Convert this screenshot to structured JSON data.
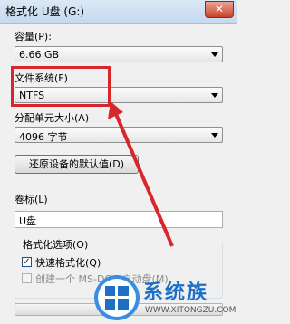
{
  "window": {
    "title": "格式化 U盘 (G:)",
    "close_glyph": "✕"
  },
  "capacity": {
    "label": "容量(P):",
    "value": "6.66 GB"
  },
  "file_system": {
    "label": "文件系统(F)",
    "value": "NTFS"
  },
  "allocation": {
    "label": "分配单元大小(A)",
    "value": "4096 字节"
  },
  "restore_button": "还原设备的默认值(D)",
  "volume_label": {
    "label": "卷标(L)",
    "value": "U盘"
  },
  "format_options": {
    "title": "格式化选项(O)",
    "quick_format": {
      "label": "快速格式化(Q)",
      "checked": true
    },
    "ms_dos_startup": {
      "label": "创建一个 MS-DOS 启动盘(M)",
      "checked": false,
      "enabled": false
    }
  },
  "watermark": {
    "name": "系统族",
    "url": "WWW.XITONGZU.COM"
  },
  "colors": {
    "highlight": "#d8262d",
    "watermark_blue": "#1e6fc6"
  }
}
